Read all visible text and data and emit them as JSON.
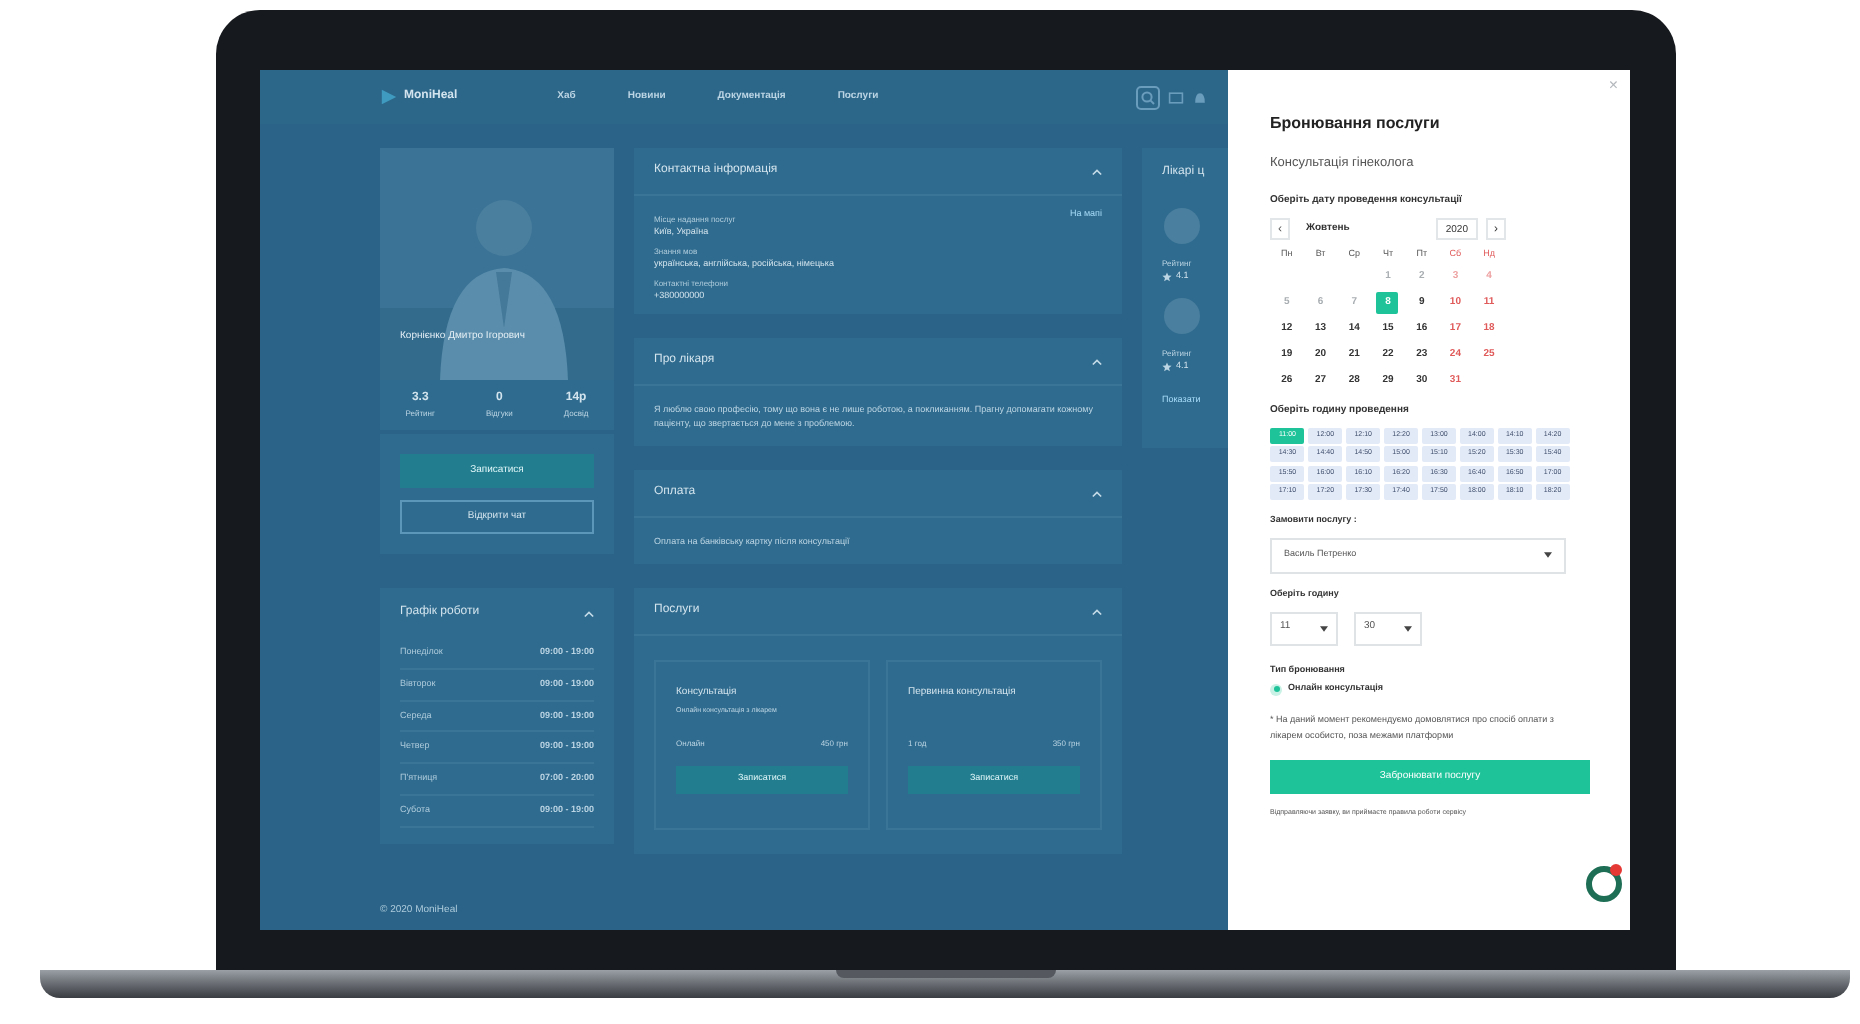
{
  "header": {
    "logo": "MoniHeal",
    "nav": [
      "Хаб",
      "Новини",
      "Документація",
      "Послуги"
    ]
  },
  "profile": {
    "name": "Корнієнко Дмитро Ігорович",
    "stats": [
      {
        "value": "3.3",
        "label": "Рейтинг"
      },
      {
        "value": "0",
        "label": "Відгуки"
      },
      {
        "value": "14р",
        "label": "Досвід"
      }
    ],
    "buttons": [
      "Записатися",
      "Відкрити чат"
    ]
  },
  "schedule": {
    "title": "Графік роботи",
    "rows": [
      {
        "day": "Понеділок",
        "hours": "09:00 - 19:00"
      },
      {
        "day": "Вівторок",
        "hours": "09:00 - 19:00"
      },
      {
        "day": "Середа",
        "hours": "09:00 - 19:00"
      },
      {
        "day": "Четвер",
        "hours": "09:00 - 19:00"
      },
      {
        "day": "П'ятниця",
        "hours": "07:00 - 20:00"
      },
      {
        "day": "Субота",
        "hours": "09:00 - 19:00"
      }
    ]
  },
  "footer": "© 2020 MoniHeal",
  "sections": [
    {
      "kind": "contact",
      "title": "Контактна інформація",
      "link": "На мапі",
      "fields": [
        {
          "label": "Місце надання послуг",
          "value": "Київ, Україна"
        },
        {
          "label": "Знання мов",
          "value": "українська, англійська, російська, німецька"
        },
        {
          "label": "Контактні телефони",
          "value": "+380000000"
        }
      ]
    },
    {
      "kind": "text",
      "title": "Про лікаря",
      "text": "Я люблю свою професію, тому що вона є не лише роботою, а покликанням. Прагну допомагати кожному пацієнту, що звертається до мене з проблемою."
    },
    {
      "kind": "text",
      "title": "Оплата",
      "text": "Оплата на банківську картку після консультації"
    },
    {
      "kind": "services",
      "title": "Послуги",
      "cards": [
        {
          "title": "Консультація",
          "description": "Онлайн консультація з лікарем",
          "format": "Онлайн",
          "price": "450 грн",
          "button": "Записатися"
        },
        {
          "title": "Первинна консультація",
          "format": "1 год",
          "price": "350 грн",
          "button": "Записатися"
        }
      ]
    }
  ],
  "doctors": {
    "title": "Лікарі ц",
    "items": [
      {
        "label": "Рейтинг",
        "rating": "4.1"
      },
      {
        "label": "Рейтинг",
        "rating": "4.1"
      }
    ],
    "link": "Показати"
  },
  "booking": {
    "title": "Бронювання послуги",
    "subtitle": "Консультація гінеколога",
    "date_label": "Оберіть дату проведення консультації",
    "month": "Жовтень",
    "year": "2020",
    "prev": "‹",
    "next": "›",
    "weekdays": [
      {
        "label": "Пн",
        "weekend": false
      },
      {
        "label": "Вт",
        "weekend": false
      },
      {
        "label": "Ср",
        "weekend": false
      },
      {
        "label": "Чт",
        "weekend": false
      },
      {
        "label": "Пт",
        "weekend": false
      },
      {
        "label": "Сб",
        "weekend": true
      },
      {
        "label": "Нд",
        "weekend": true
      }
    ],
    "weeks": [
      [
        {
          "day": "1",
          "weekend": false,
          "disabled": true,
          "selected": false
        },
        {
          "day": "2",
          "weekend": false,
          "disabled": true,
          "selected": false
        },
        {
          "day": "3",
          "weekend": true,
          "disabled": true,
          "selected": false
        },
        {
          "day": "4",
          "weekend": true,
          "disabled": true,
          "selected": false
        }
      ],
      [
        {
          "day": "5",
          "weekend": false,
          "disabled": true,
          "selected": false
        },
        {
          "day": "6",
          "weekend": false,
          "disabled": true,
          "selected": false
        },
        {
          "day": "7",
          "weekend": false,
          "disabled": true,
          "selected": false
        },
        {
          "day": "8",
          "weekend": false,
          "disabled": false,
          "selected": true
        },
        {
          "day": "9",
          "weekend": false,
          "disabled": false,
          "selected": false
        },
        {
          "day": "10",
          "weekend": true,
          "disabled": false,
          "selected": false
        },
        {
          "day": "11",
          "weekend": true,
          "disabled": false,
          "selected": false
        }
      ],
      [
        {
          "day": "12",
          "weekend": false,
          "disabled": false,
          "selected": false
        },
        {
          "day": "13",
          "weekend": false,
          "disabled": false,
          "selected": false
        },
        {
          "day": "14",
          "weekend": false,
          "disabled": false,
          "selected": false
        },
        {
          "day": "15",
          "weekend": false,
          "disabled": false,
          "selected": false
        },
        {
          "day": "16",
          "weekend": false,
          "disabled": false,
          "selected": false
        },
        {
          "day": "17",
          "weekend": true,
          "disabled": false,
          "selected": false
        },
        {
          "day": "18",
          "weekend": true,
          "disabled": false,
          "selected": false
        }
      ],
      [
        {
          "day": "19",
          "weekend": false,
          "disabled": false,
          "selected": false
        },
        {
          "day": "20",
          "weekend": false,
          "disabled": false,
          "selected": false
        },
        {
          "day": "21",
          "weekend": false,
          "disabled": false,
          "selected": false
        },
        {
          "day": "22",
          "weekend": false,
          "disabled": false,
          "selected": false
        },
        {
          "day": "23",
          "weekend": false,
          "disabled": false,
          "selected": false
        },
        {
          "day": "24",
          "weekend": true,
          "disabled": false,
          "selected": false
        },
        {
          "day": "25",
          "weekend": true,
          "disabled": false,
          "selected": false
        }
      ],
      [
        {
          "day": "26",
          "weekend": false,
          "disabled": false,
          "selected": false
        },
        {
          "day": "27",
          "weekend": false,
          "disabled": false,
          "selected": false
        },
        {
          "day": "28",
          "weekend": false,
          "disabled": false,
          "selected": false
        },
        {
          "day": "29",
          "weekend": false,
          "disabled": false,
          "selected": false
        },
        {
          "day": "30",
          "weekend": false,
          "disabled": false,
          "selected": false
        },
        {
          "day": "31",
          "weekend": true,
          "disabled": false,
          "selected": false
        }
      ]
    ],
    "time_label": "Оберіть годину проведення",
    "slots": [
      {
        "time": "11:00",
        "selected": true
      },
      {
        "time": "12:00",
        "selected": false
      },
      {
        "time": "12:10",
        "selected": false
      },
      {
        "time": "12:20",
        "selected": false
      },
      {
        "time": "13:00",
        "selected": false
      },
      {
        "time": "14:00",
        "selected": false
      },
      {
        "time": "14:10",
        "selected": false
      },
      {
        "time": "14:20",
        "selected": false
      },
      {
        "time": "14:30",
        "selected": false
      },
      {
        "time": "14:40",
        "selected": false
      },
      {
        "time": "14:50",
        "selected": false
      },
      {
        "time": "15:00",
        "selected": false
      },
      {
        "time": "15:10",
        "selected": false
      },
      {
        "time": "15:20",
        "selected": false
      },
      {
        "time": "15:30",
        "selected": false
      },
      {
        "time": "15:40",
        "selected": false
      },
      {
        "time": "15:50",
        "selected": false
      },
      {
        "time": "16:00",
        "selected": false
      },
      {
        "time": "16:10",
        "selected": false
      },
      {
        "time": "16:20",
        "selected": false
      },
      {
        "time": "16:30",
        "selected": false
      },
      {
        "time": "16:40",
        "selected": false
      },
      {
        "time": "16:50",
        "selected": false
      },
      {
        "time": "17:00",
        "selected": false
      },
      {
        "time": "17:10",
        "selected": false
      },
      {
        "time": "17:20",
        "selected": false
      },
      {
        "time": "17:30",
        "selected": false
      },
      {
        "time": "17:40",
        "selected": false
      },
      {
        "time": "17:50",
        "selected": false
      },
      {
        "time": "18:00",
        "selected": false
      },
      {
        "time": "18:10",
        "selected": false
      },
      {
        "time": "18:20",
        "selected": false
      }
    ],
    "service_label": "Замовити послугу :",
    "service_value": "Василь Петренко",
    "hours_label": "Оберіть годину",
    "hour": "11",
    "minute": "30",
    "type_label": "Тип бронювання",
    "types": [
      {
        "label": "Онлайн консультація",
        "selected": true
      }
    ],
    "note": "* На даний момент рекомендуємо домовлятися про спосіб оплати з лікарем особисто, поза межами платформи",
    "button": "Забронювати послугу",
    "footer": "Відправляючи заявку, ви приймаєте правила роботи сервісу",
    "close": "×"
  }
}
